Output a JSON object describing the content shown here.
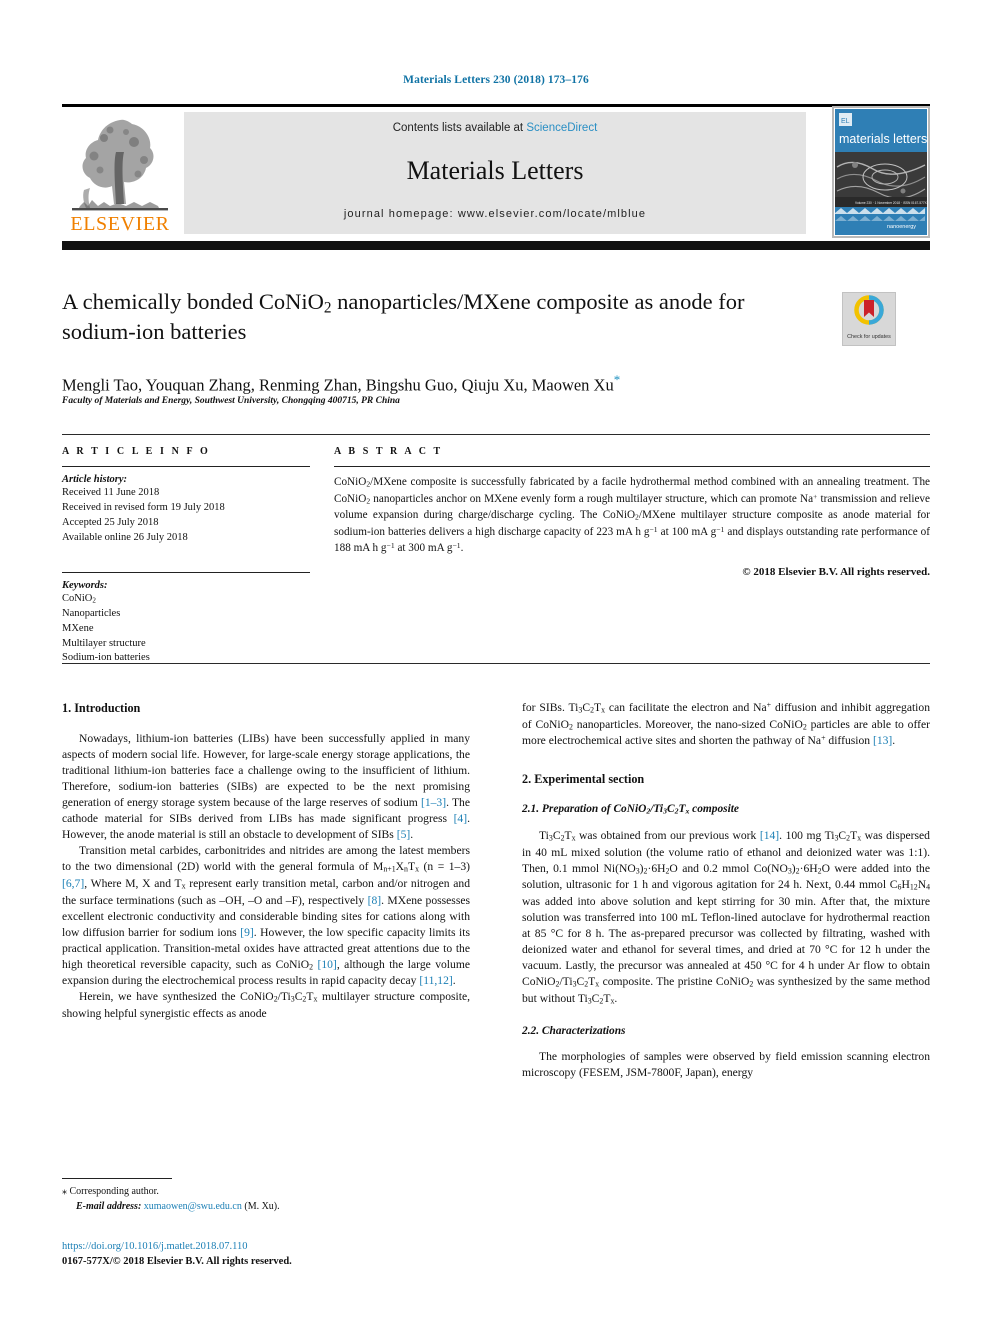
{
  "running_head": "Materials Letters 230 (2018) 173–176",
  "banner": {
    "publisher_logo_text": "ELSEVIER",
    "contents_prefix": "Contents lists available at ",
    "contents_link": "ScienceDirect",
    "journal_title": "Materials Letters",
    "homepage_line": "journal homepage: www.elsevier.com/locate/mlblue",
    "cover_journal_name": "materials letters",
    "cover_footer_text": "nanoenergy"
  },
  "article": {
    "title": "A chemically bonded CoNiO2 nanoparticles/MXene composite as anode for sodium-ion batteries",
    "authors": "Mengli Tao, Youquan Zhang, Renming Zhan, Bingshu Guo, Qiuju Xu, Maowen Xu",
    "corresponding_marker": "*",
    "affiliation": "Faculty of Materials and Energy, Southwest University, Chongqing 400715, PR China",
    "crossmark_label": "Check for updates"
  },
  "article_info": {
    "heading": "A R T I C L E   I N F O",
    "history_label": "Article history:",
    "history": [
      "Received 11 June 2018",
      "Received in revised form 19 July 2018",
      "Accepted 25 July 2018",
      "Available online 26 July 2018"
    ],
    "keywords_label": "Keywords:",
    "keywords": [
      "CoNiO2",
      "Nanoparticles",
      "MXene",
      "Multilayer structure",
      "Sodium-ion batteries"
    ]
  },
  "abstract": {
    "heading": "A B S T R A C T",
    "text": "CoNiO2/MXene composite is successfully fabricated by a facile hydrothermal method combined with an annealing treatment. The CoNiO2 nanoparticles anchor on MXene evenly form a rough multilayer structure, which can promote Na+ transmission and relieve volume expansion during charge/discharge cycling. The CoNiO2/MXene multilayer structure composite as anode material for sodium-ion batteries delivers a high discharge capacity of 223 mA h g-1 at 100 mA g-1 and displays outstanding rate performance of 188 mA h g-1 at 300 mA g-1.",
    "copyright": "© 2018 Elsevier B.V. All rights reserved."
  },
  "sections": {
    "introduction_heading": "1. Introduction",
    "intro_p1": "Nowadays, lithium-ion batteries (LIBs) have been successfully applied in many aspects of modern social life. However, for large-scale energy storage applications, the traditional lithium-ion batteries face a challenge owing to the insufficient of lithium. Therefore, sodium-ion batteries (SIBs) are expected to be the next promising generation of energy storage system because of the large reserves of sodium [1–3]. The cathode material for SIBs derived from LIBs has made significant progress [4]. However, the anode material is still an obstacle to development of SIBs [5].",
    "intro_p2": "Transition metal carbides, carbonitrides and nitrides are among the latest members to the two dimensional (2D) world with the general formula of Mn+1XnTx (n = 1–3) [6,7], Where M, X and Tx represent early transition metal, carbon and/or nitrogen and the surface terminations (such as –OH, –O and –F), respectively [8]. MXene possesses excellent electronic conductivity and considerable binding sites for cations along with low diffusion barrier for sodium ions [9]. However, the low specific capacity limits its practical application. Transition-metal oxides have attracted great attentions due to the high theoretical reversible capacity, such as CoNiO2 [10], although the large volume expansion during the electrochemical process results in rapid capacity decay [11,12].",
    "intro_p3": "Herein, we have synthesized the CoNiO2/Ti3C2Tx multilayer structure composite, showing helpful synergistic effects as anode",
    "intro_p3_cont": "for SIBs. Ti3C2Tx can facilitate the electron and Na+ diffusion and inhibit aggregation of CoNiO2 nanoparticles. Moreover, the nano-sized CoNiO2 particles are able to offer more electrochemical active sites and shorten the pathway of Na+ diffusion [13].",
    "experimental_heading": "2. Experimental section",
    "sub_21_heading": "2.1. Preparation of CoNiO2/Ti3C2Tx composite",
    "sub_21_p1": "Ti3C2Tx was obtained from our previous work [14]. 100 mg Ti3C2Tx was dispersed in 40 mL mixed solution (the volume ratio of ethanol and deionized water was 1:1). Then, 0.1 mmol Ni(NO3)2·6H2O and 0.2 mmol Co(NO3)2·6H2O were added into the solution, ultrasonic for 1 h and vigorous agitation for 24 h. Next, 0.44 mmol C6H12N4 was added into above solution and kept stirring for 30 min. After that, the mixture solution was transferred into 100 mL Teflon-lined autoclave for hydrothermal reaction at 85 °C for 8 h. The as-prepared precursor was collected by filtrating, washed with deionized water and ethanol for several times, and dried at 70 °C for 12 h under the vacuum. Lastly, the precursor was annealed at 450 °C for 4 h under Ar flow to obtain CoNiO2/Ti3C2Tx composite. The pristine CoNiO2 was synthesized by the same method but without Ti3C2Tx.",
    "sub_22_heading": "2.2. Characterizations",
    "sub_22_p1": "The morphologies of samples were observed by field emission scanning electron microscopy (FESEM, JSM-7800F, Japan), energy"
  },
  "footer": {
    "corresponding_author": "Corresponding author.",
    "email_label": "E-mail address:",
    "email": "xumaowen@swu.edu.cn",
    "email_suffix": "(M. Xu).",
    "doi": "https://doi.org/10.1016/j.matlet.2018.07.110",
    "issn_line": "0167-577X/© 2018 Elsevier B.V. All rights reserved."
  },
  "colors": {
    "link": "#1b7fb5",
    "running_head": "#1073a5",
    "sciencedirect": "#2a8fc4",
    "elsevier_orange": "#f08000",
    "cover_blue": "#2f7fb5"
  }
}
